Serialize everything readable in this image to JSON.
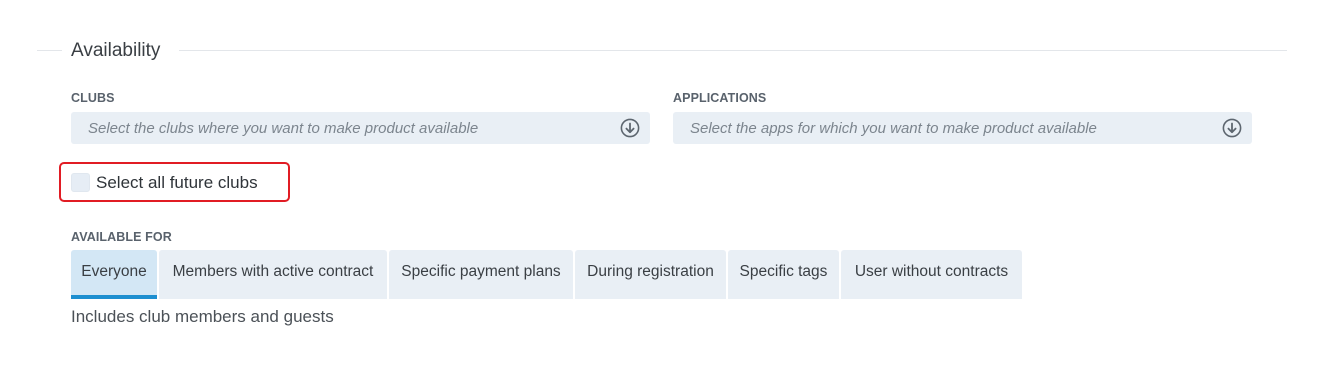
{
  "section": {
    "title": "Availability"
  },
  "clubs": {
    "label": "CLUBS",
    "placeholder": "Select the clubs where you want to make product available",
    "icon": "arrow-down-circle-icon"
  },
  "applications": {
    "label": "APPLICATIONS",
    "placeholder": "Select the apps for which you want to make product available",
    "icon": "arrow-down-circle-icon"
  },
  "future_clubs": {
    "label": "Select all future clubs",
    "checked": false
  },
  "available_for": {
    "label": "AVAILABLE FOR",
    "tabs": [
      {
        "label": "Everyone",
        "active": true
      },
      {
        "label": "Members with active contract",
        "active": false
      },
      {
        "label": "Specific payment plans",
        "active": false
      },
      {
        "label": "During registration",
        "active": false
      },
      {
        "label": "Specific tags",
        "active": false
      },
      {
        "label": "User without contracts",
        "active": false
      }
    ],
    "description": "Includes club members and guests"
  },
  "colors": {
    "accent": "#1d8fd0",
    "highlight": "#e11c24",
    "field_background": "#e9eff5"
  }
}
